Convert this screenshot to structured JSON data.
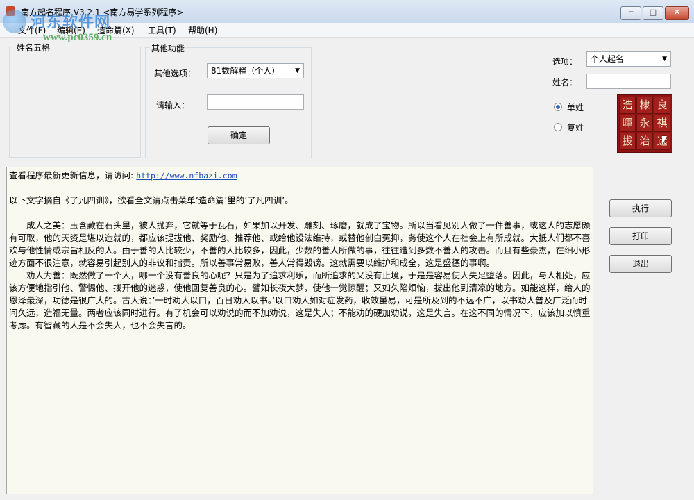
{
  "window": {
    "title": "南方起名程序 V3.2.1  <南方易学系列程序>",
    "controls": {
      "minimize": "─",
      "maximize": "□",
      "close": "✕"
    }
  },
  "watermark": {
    "site": "河东软件网",
    "url": "www.pc0359.cn"
  },
  "menu": [
    "文件(F)",
    "编辑(E)",
    "造命篇(X)",
    "工具(T)",
    "帮助(H)"
  ],
  "left_panel": {
    "title": "姓名五格"
  },
  "other_functions": {
    "title": "其他功能",
    "option_label": "其他选项：",
    "option_value": "81数解释（个人）",
    "input_label": "请输入：",
    "input_value": "",
    "confirm_label": "确定"
  },
  "right_panel": {
    "option_label": "选项：",
    "option_value": "个人起名",
    "surname_label": "姓名：",
    "surname_value": "",
    "single_surname": "单姓",
    "double_surname": "复姓",
    "single_selected": true
  },
  "stamp_chars": [
    "浩",
    "棣",
    "良",
    "暉",
    "永",
    "祺",
    "拔",
    "治",
    "远"
  ],
  "actions": {
    "execute": "执行",
    "print": "打印",
    "exit": "退出"
  },
  "content": {
    "update_prefix": "查看程序最新更新信息，请访问: ",
    "update_url": "http://www.nfbazi.com",
    "intro": "以下文字摘自《了凡四训》，欲看全文请点击菜单’造命篇’里的’了凡四训’。",
    "para1": "成人之美：玉含藏在石头里，被人抛弃，它就等于瓦石，如果加以开发、雕刻、琢磨，就成了宝物。所以当看见别人做了一件善事，或这人的志愿颇有可取，他的天资是堪以造就的，都应该提拔他、奖励他、推荐他、或给他设法维持，或替他剖白冤抑，务使这个人在社会上有所成就。大抵人们都不喜欢与他性情或宗旨相反的人。由于善的人比较少，不善的人比较多，因此，少数的善人所做的事，往往遭到多数不善人的攻击。而且有些豪杰，在细小形迹方面不很注意，就容易引起别人的非议和指责。所以善事常易败，善人常得毁谤。这就需要以维护和成全，这是盛德的事啊。",
    "para2": "劝人为善：既然做了一个人，哪一个没有善良的心呢？只是为了追求利乐，而所追求的又没有止境，于是是容易使人失足堕落。因此，与人相处，应该方便地指引他、警惕他、拨开他的迷惑，使他回复善良的心。譬如长夜大梦，使他一觉惊醒；又如久陷烦恼，拔出他到清凉的地方。如能这样，给人的恩泽最深，功德是很广大的。古人说：’一时劝人以口，百日劝人以书。’以口劝人如对症发药，收效虽易，可是所及到的不远不广，以书劝人普及广泛而时间久远，造福无量。两者应该同时进行。有了机会可以劝说的而不加劝说，这是失人；不能劝的硬加劝说，这是失言。在这不同的情况下，应该加以慎重考虑。有智藏的人是不会失人，也不会失言的。"
  }
}
